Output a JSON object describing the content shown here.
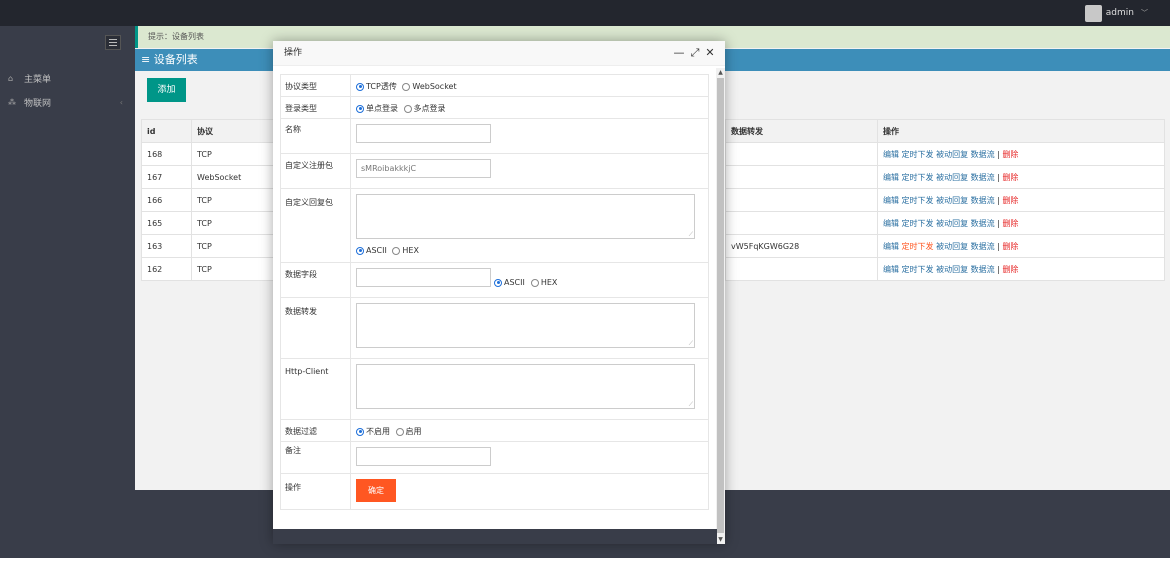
{
  "topbar": {
    "user": "admin"
  },
  "sidebar": {
    "items": [
      {
        "label": "主菜单",
        "icon": "home-icon"
      },
      {
        "label": "物联网",
        "icon": "sitemap-icon"
      }
    ]
  },
  "main": {
    "hint": "提示：设备列表",
    "title": "≡ 设备列表",
    "add_label": "添加",
    "columns": {
      "id": "id",
      "protocol": "协议",
      "forward": "数据转发",
      "action": "操作"
    },
    "rows": [
      {
        "id": "168",
        "protocol": "TCP",
        "forward": ""
      },
      {
        "id": "167",
        "protocol": "WebSocket",
        "forward": ""
      },
      {
        "id": "166",
        "protocol": "TCP",
        "forward": ""
      },
      {
        "id": "165",
        "protocol": "TCP",
        "forward": ""
      },
      {
        "id": "163",
        "protocol": "TCP",
        "forward": "vW5FqKGW6G28"
      },
      {
        "id": "162",
        "protocol": "TCP",
        "forward": ""
      }
    ],
    "actions": {
      "edit": "编辑",
      "timed": "定时下发",
      "passive": "被动回复",
      "stream": "数据流",
      "sep": "|",
      "delete": "删除"
    }
  },
  "modal": {
    "title": "操作",
    "fields": {
      "protocol_label": "协议类型",
      "protocol_opt1": "TCP透传",
      "protocol_opt2": "WebSocket",
      "login_label": "登录类型",
      "login_opt1": "单点登录",
      "login_opt2": "多点登录",
      "name_label": "名称",
      "name_value": "",
      "reg_label": "自定义注册包",
      "reg_value": "sMRoibakkkjC",
      "reply_label": "自定义回复包",
      "ascii": "ASCII",
      "hex": "HEX",
      "field_label": "数据字段",
      "forward_label": "数据转发",
      "http_label": "Http-Client",
      "filter_label": "数据过滤",
      "filter_opt1": "不启用",
      "filter_opt2": "启用",
      "note_label": "备注",
      "op_label": "操作",
      "confirm": "确定"
    }
  }
}
